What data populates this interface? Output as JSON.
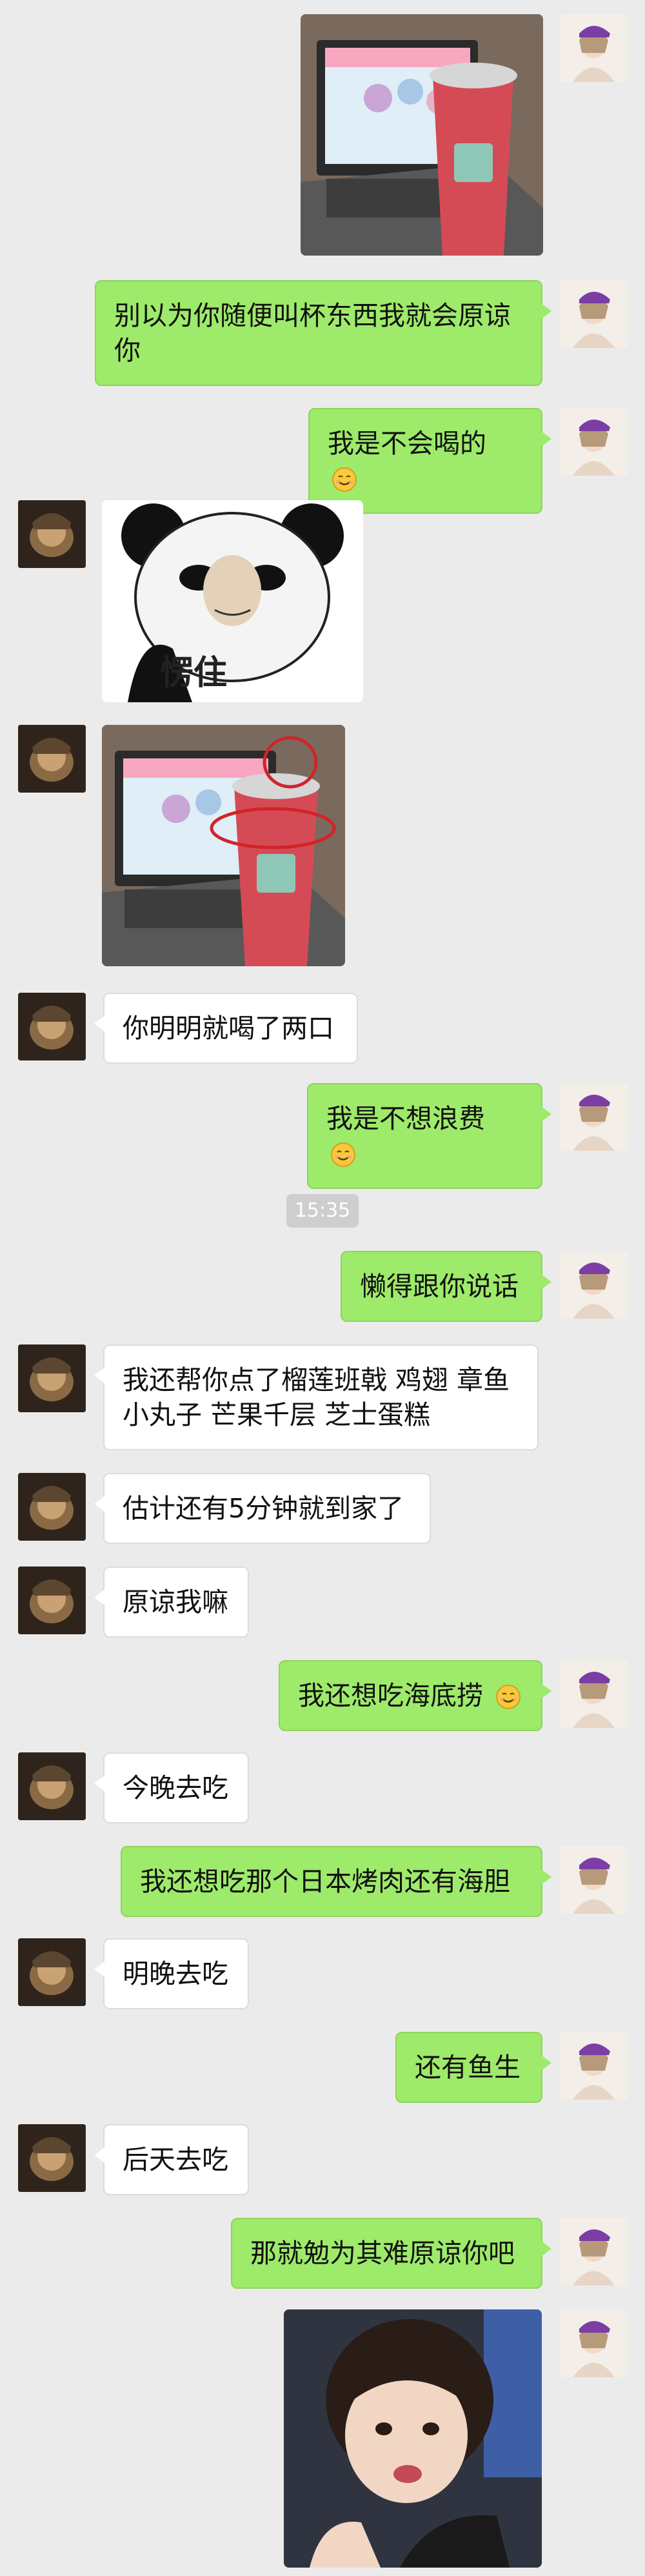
{
  "time_divider": "15:35",
  "messages": {
    "m1": "别以为你随便叫杯东西我就会原谅你",
    "m2": "我是不会喝的",
    "sticker_text": "愣住",
    "m4": "你明明就喝了两口",
    "m5": "我是不想浪费",
    "m6": "懒得跟你说话",
    "m7": "我还帮你点了榴莲班戟 鸡翅 章鱼小丸子 芒果千层 芝士蛋糕",
    "m8": "估计还有5分钟就到家了",
    "m9": "原谅我嘛",
    "m10": "我还想吃海底捞",
    "m11": "今晚去吃",
    "m12": "我还想吃那个日本烤肉还有海胆",
    "m13": "明晚去吃",
    "m14": "还有鱼生",
    "m15": "后天去吃",
    "m16": "那就勉为其难原谅你吧"
  },
  "icons": {
    "smile": "smile-emoji-icon"
  },
  "colors": {
    "outgoing_bubble": "#9eea6a",
    "incoming_bubble": "#ffffff",
    "background": "#ebebeb",
    "time_badge": "#cecece"
  }
}
